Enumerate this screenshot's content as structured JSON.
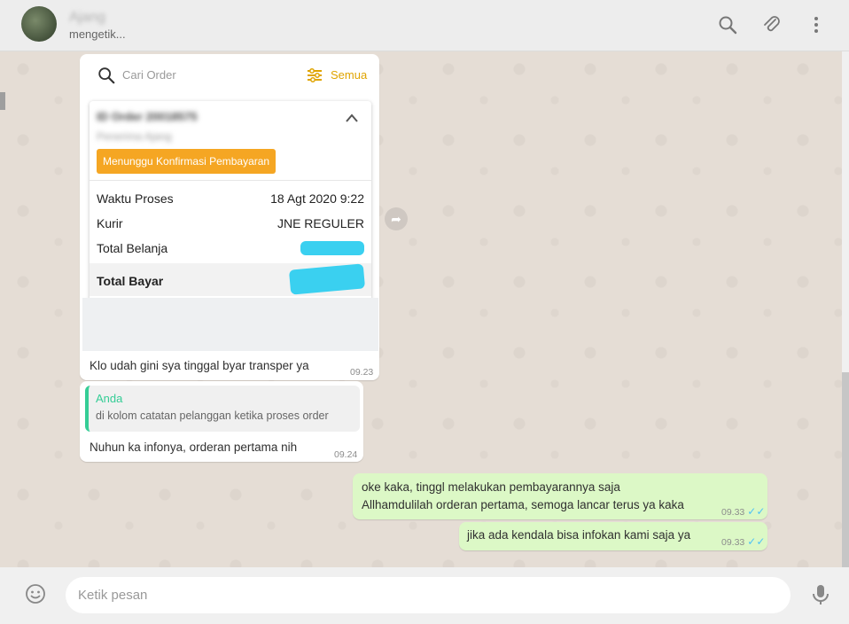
{
  "header": {
    "contact_name": "Ajang",
    "status": "mengetik..."
  },
  "icons": {
    "search": "search-icon",
    "attach": "paperclip-icon",
    "menu": "more-vert-icon",
    "emoji": "emoji-icon",
    "mic": "mic-icon",
    "forward": "forward-icon"
  },
  "shared_image": {
    "search_placeholder": "Cari Order",
    "filter_label": "Semua",
    "order_id": "ID Order 20018575",
    "recipient": "Penerima Ajang",
    "status_badge": "Menunggu Konfirmasi Pembayaran",
    "rows": [
      {
        "label": "Waktu Proses",
        "value": "18 Agt 2020 9:22"
      },
      {
        "label": "Kurir",
        "value": "JNE REGULER"
      },
      {
        "label": "Total Belanja",
        "value": ""
      },
      {
        "label": "Total Bayar",
        "value": ""
      }
    ]
  },
  "messages": {
    "m1": {
      "text": "Klo udah gini sya tinggal byar transper ya",
      "time": "09.23"
    },
    "m2": {
      "quote_author": "Anda",
      "quote_text": "di kolom catatan pelanggan ketika proses order",
      "text": "Nuhun ka infonya, orderan pertama nih",
      "time": "09.24"
    },
    "m3": {
      "line1": "oke kaka, tinggl melakukan pembayarannya saja",
      "line2": "Allhamdulilah orderan pertama, semoga lancar terus ya kaka",
      "time": "09.33"
    },
    "m4": {
      "text": "jika ada kendala bisa infokan kami saja ya",
      "time": "09.33"
    }
  },
  "composer": {
    "placeholder": "Ketik pesan"
  },
  "colors": {
    "outgoing_bubble": "#dcf8c6",
    "incoming_bubble": "#ffffff",
    "badge": "#f5a623",
    "accent_green": "#35cd96",
    "read_ticks": "#4fc3f7"
  }
}
